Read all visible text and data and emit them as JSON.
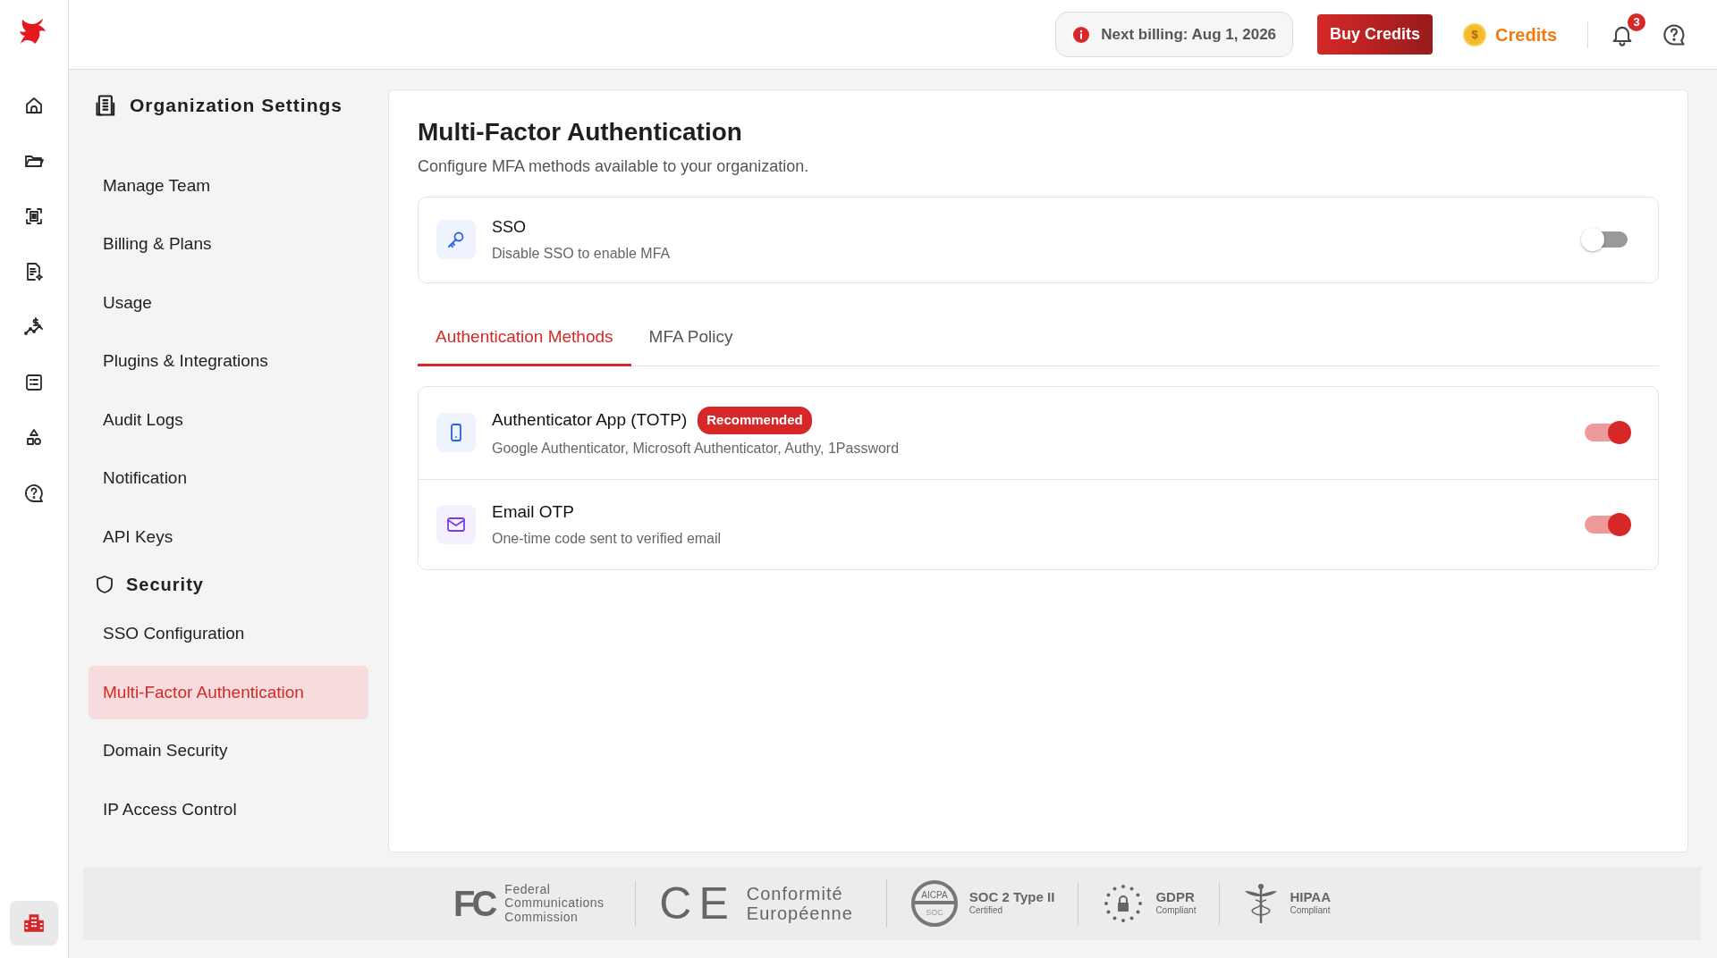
{
  "rail": {
    "items": [
      {
        "kind": "home",
        "selected": false
      },
      {
        "kind": "folder",
        "selected": false
      },
      {
        "kind": "scan",
        "selected": false
      },
      {
        "kind": "doc",
        "selected": false
      },
      {
        "kind": "dollar-chart",
        "selected": false
      },
      {
        "kind": "list",
        "selected": false
      },
      {
        "kind": "shapes",
        "selected": false
      },
      {
        "kind": "help",
        "selected": false
      }
    ],
    "bottom": {
      "kind": "building",
      "selected": true
    }
  },
  "topbar": {
    "billing": "Next billing: Aug 1, 2026",
    "buy_button": "Buy Credits",
    "credits": "Credits",
    "coin": "$",
    "notification_count": "3"
  },
  "sidebar": {
    "title": "Organization Settings",
    "items": [
      {
        "kind": "item",
        "label": "Manage Team",
        "selected": false
      },
      {
        "kind": "item",
        "label": "Billing & Plans",
        "selected": false
      },
      {
        "kind": "item",
        "label": "Usage",
        "selected": false
      },
      {
        "kind": "item",
        "label": "Plugins & Integrations",
        "selected": false
      },
      {
        "kind": "item",
        "label": "Audit Logs",
        "selected": false
      },
      {
        "kind": "item",
        "label": "Notification",
        "selected": false
      },
      {
        "kind": "item",
        "label": "API Keys",
        "selected": false
      },
      {
        "kind": "header",
        "label": "Security"
      },
      {
        "kind": "item",
        "label": "SSO Configuration",
        "selected": false
      },
      {
        "kind": "item",
        "label": "Multi-Factor Authentication",
        "selected": true
      },
      {
        "kind": "item",
        "label": "Domain Security",
        "selected": false
      },
      {
        "kind": "item",
        "label": "IP Access Control",
        "selected": false
      }
    ]
  },
  "main": {
    "title": "Multi-Factor Authentication",
    "subtitle": "Configure MFA methods available to your organization.",
    "sso": {
      "kind": "key",
      "title": "SSO",
      "description": "Disable SSO to enable MFA",
      "on": false,
      "color": "#2563eb"
    },
    "tabs": [
      {
        "label": "Authentication Methods",
        "selected": true
      },
      {
        "label": "MFA Policy",
        "selected": false
      }
    ],
    "methods": [
      {
        "kind": "phone",
        "title": "Authenticator App (TOTP)",
        "badge": "Recommended",
        "description": "Google Authenticator, Microsoft Authenticator, Authy, 1Password",
        "on": true,
        "color": "#2563eb"
      },
      {
        "kind": "mail",
        "title": "Email OTP",
        "description": "One-time code sent to verified email",
        "on": true,
        "color": "#7c3aed"
      }
    ]
  },
  "footer": {
    "certifications": [
      {
        "kind": "fcc",
        "mark": "FC",
        "name": "Federal Communications Commission"
      },
      {
        "kind": "ce",
        "mark": "CE",
        "name": "Conformité Européenne"
      },
      {
        "kind": "soc",
        "seal_top": "AICPA",
        "seal_bottom": "SOC",
        "name": "SOC 2 Type II",
        "note": "Certified"
      },
      {
        "kind": "gdpr",
        "name": "GDPR",
        "note": "Compliant"
      },
      {
        "kind": "hipaa",
        "name": "HIPAA",
        "note": "Compliant"
      }
    ]
  }
}
